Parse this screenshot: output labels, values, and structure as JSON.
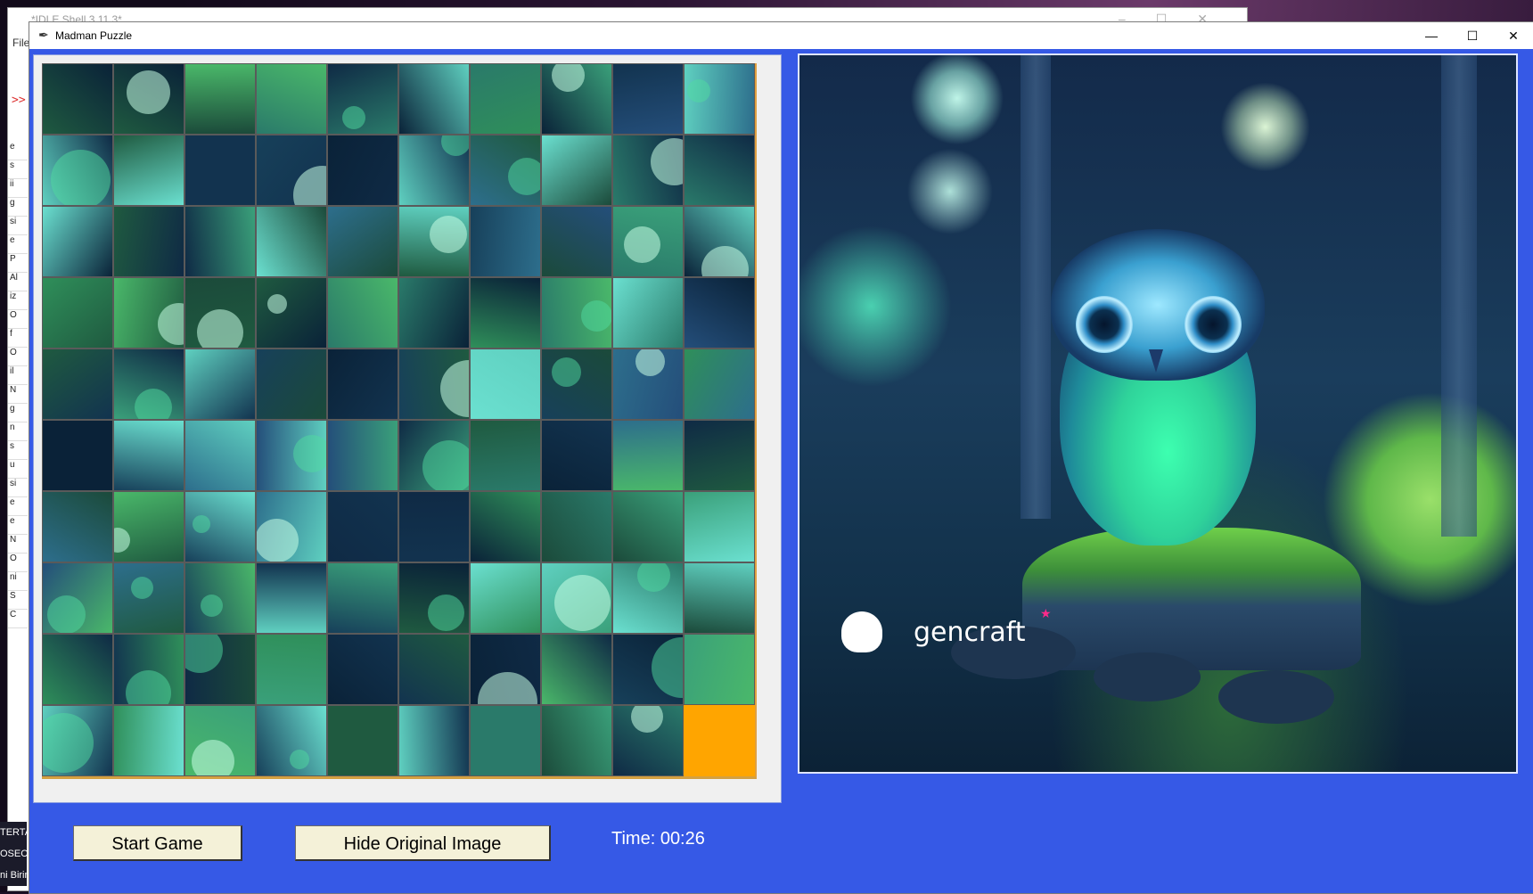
{
  "background_window": {
    "title": "*IDLE Shell 3.11.3*",
    "menu_first": "File",
    "prompt": ">>",
    "side_letters": [
      "e",
      "s",
      "ii",
      "g",
      "si",
      "e",
      "P",
      "Al",
      "iz",
      "O",
      "f",
      "O",
      "il",
      "N",
      "g",
      "n",
      "s",
      "u",
      "si",
      "e",
      "e",
      "N",
      "O",
      "ni",
      "S",
      "C"
    ],
    "taskbar_items": [
      "TERTA",
      "OSECO",
      "ni Birin"
    ]
  },
  "window": {
    "title": "Madman Puzzle",
    "icon": "feather-icon",
    "controls": {
      "minimize": "—",
      "maximize": "☐",
      "close": "✕"
    },
    "background_color": "#3659e6"
  },
  "puzzle": {
    "rows": 10,
    "cols": 10,
    "empty_tile_color": "#ffa500",
    "empty_tile_index": 99
  },
  "original_image": {
    "watermark": "gencraft",
    "subject": "owl-illustration"
  },
  "controls": {
    "start_label": "Start Game",
    "hide_label": "Hide Original Image",
    "timer_text": "Time: 00:26"
  }
}
